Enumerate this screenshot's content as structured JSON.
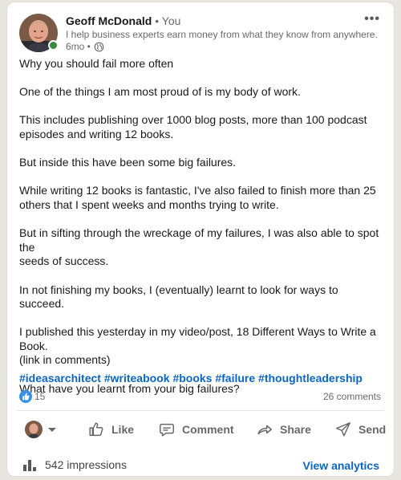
{
  "colors": {
    "accent": "#0a66c2",
    "online": "#378b3c",
    "like_badge": "#378fe9",
    "background": "#e9e5df"
  },
  "post": {
    "author": {
      "name": "Geoff McDonald",
      "you_tag": "• You",
      "headline": "I help business experts earn money from what they know from anywhere.",
      "age": "6mo •",
      "visibility_icon": "globe-icon",
      "status": "online"
    },
    "paragraphs": [
      "Why you should fail more often",
      "One of the things I am most proud of is my body of work.",
      "This includes publishing over 1000 blog posts, more than 100 podcast\nepisodes and writing 12 books.",
      "But inside this have been some big failures.",
      "While writing 12 books is fantastic, I've also failed to finish more than 25\nothers that I spent weeks and months trying to write.",
      "But in sifting through the wreckage of my failures, I was also able to spot the\nseeds of success.",
      "In not finishing my books, I (eventually) learnt to look for ways to succeed.",
      "I published this yesterday in my video/post, 18 Different Ways to Write a Book.\n(link in comments)",
      "What have you learnt from your big failures?"
    ],
    "hashtags": [
      "#ideasarchitect",
      "#writeabook",
      "#books",
      "#failure",
      "#thoughtleadership"
    ],
    "reactions_count": "15",
    "comments_count": "26 comments"
  },
  "actions": {
    "like": "Like",
    "comment": "Comment",
    "share": "Share",
    "send": "Send"
  },
  "footer": {
    "impressions": "542 impressions",
    "view_analytics": "View analytics"
  }
}
